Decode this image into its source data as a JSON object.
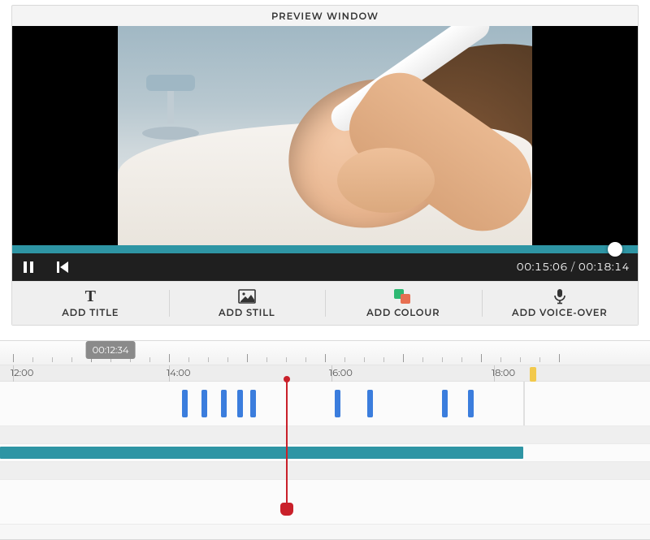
{
  "preview": {
    "title": "PREVIEW WINDOW",
    "time_current": "00:15:06",
    "time_total": "00:18:14"
  },
  "toolbar": {
    "title": {
      "label": "ADD TITLE"
    },
    "still": {
      "label": "ADD STILL"
    },
    "colour": {
      "label": "ADD COLOUR"
    },
    "voice": {
      "label": "ADD VOICE-OVER"
    }
  },
  "timeline": {
    "tooltip_time": "00:12:34",
    "tooltip_pos_pct": 17,
    "playhead_pos_pct": 44,
    "clip_end_pct": 80.5,
    "yellow_marker_pct": 81.5,
    "hours": [
      {
        "label": "12:00",
        "pct": 2
      },
      {
        "label": "14:00",
        "pct": 26
      },
      {
        "label": "16:00",
        "pct": 51
      },
      {
        "label": "18:00",
        "pct": 76
      }
    ],
    "minor_tick_pcts": [
      2,
      5,
      8,
      11,
      14,
      17,
      20,
      23,
      26,
      29,
      32,
      35,
      38,
      41,
      44,
      47,
      50,
      53,
      56,
      59,
      62,
      65,
      68,
      71,
      74,
      77,
      80,
      83,
      86
    ],
    "blue_markers_pct": [
      28,
      31,
      34,
      36.5,
      38.5,
      51.5,
      56.5,
      68,
      72
    ],
    "teal_block": {
      "start_pct": 0,
      "end_pct": 80.5
    }
  }
}
